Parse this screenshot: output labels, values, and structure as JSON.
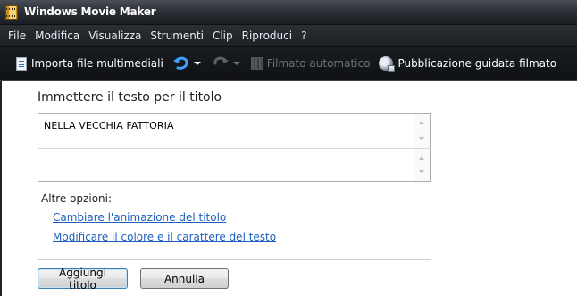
{
  "window": {
    "title": "Windows Movie Maker"
  },
  "menu": {
    "items": [
      "File",
      "Modifica",
      "Visualizza",
      "Strumenti",
      "Clip",
      "Riproduci",
      "?"
    ]
  },
  "toolbar": {
    "import_label": "Importa file multimediali",
    "automovie_label": "Filmato automatico",
    "publish_label": "Pubblicazione guidata filmato"
  },
  "title_editor": {
    "prompt": "Immettere il testo per il titolo",
    "title_text": "NELLA VECCHIA FATTORIA",
    "subtitle_text": ""
  },
  "options": {
    "heading": "Altre opzioni:",
    "links": [
      "Cambiare l'animazione del titolo",
      "Modificare il colore e il carattere del testo"
    ]
  },
  "buttons": {
    "add_title": "Aggiungi titolo",
    "cancel": "Annulla"
  },
  "colors": {
    "link": "#1f5fbf",
    "chrome_dark": "#1e2125"
  }
}
